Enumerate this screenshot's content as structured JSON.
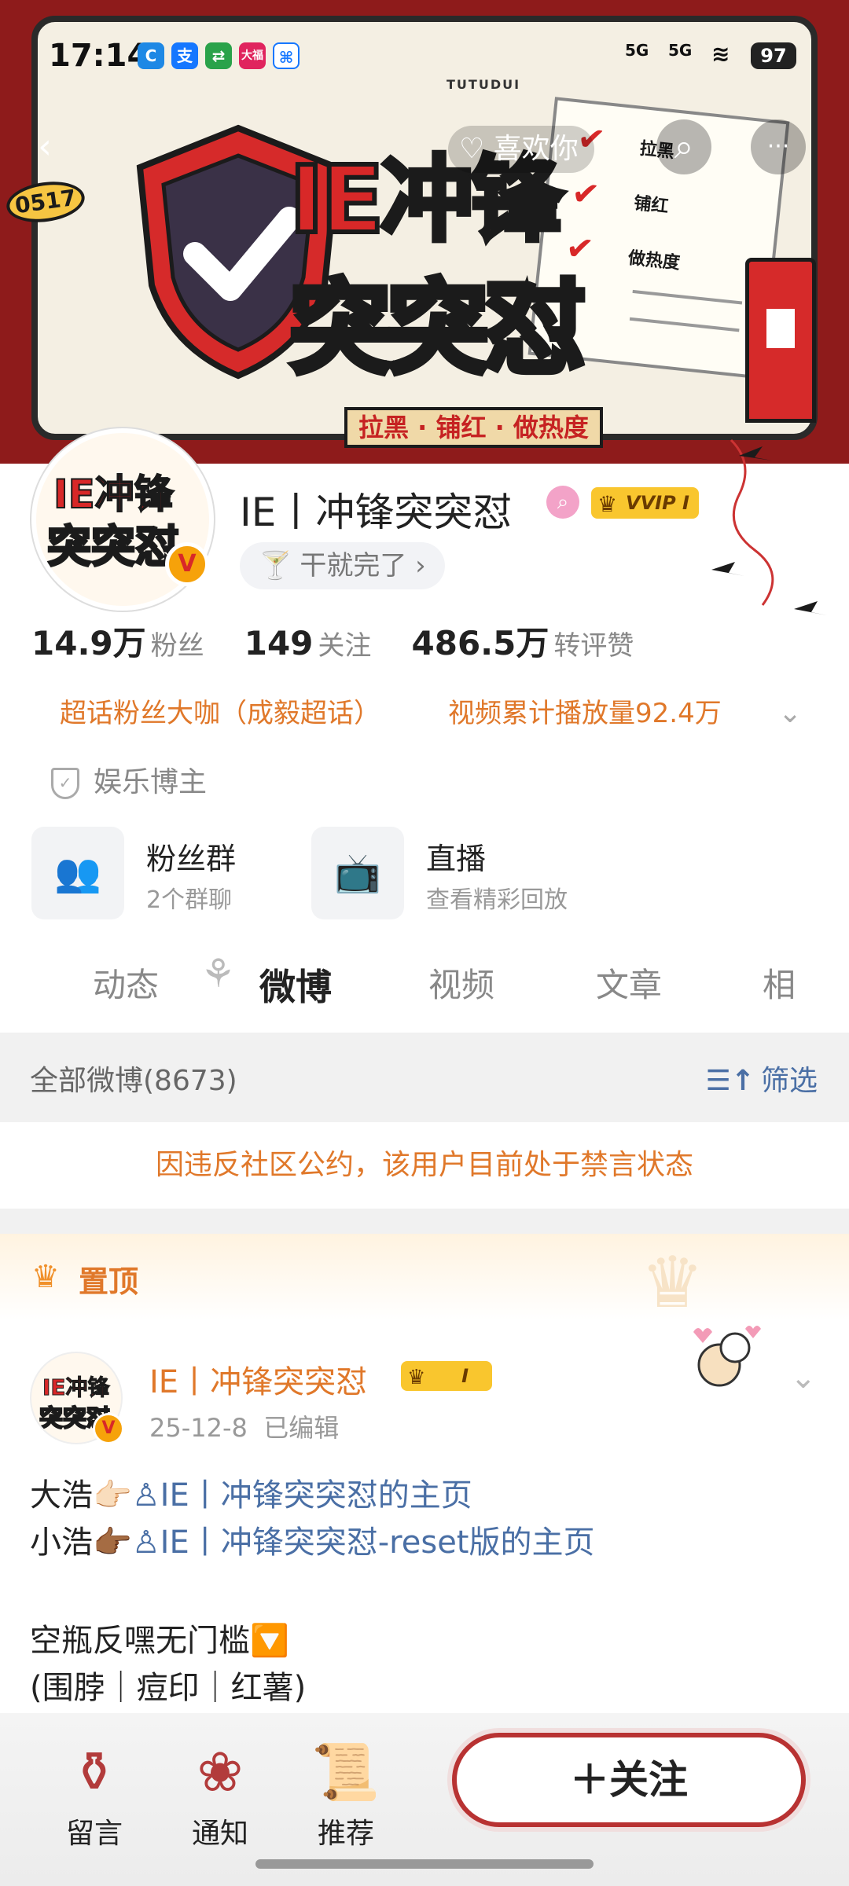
{
  "status_bar": {
    "time": "17:14",
    "signal_1": "5G",
    "signal_2": "5G",
    "battery": "97",
    "app_icon_labels": [
      "大福"
    ]
  },
  "banner": {
    "brand": "TUTUDUI",
    "title_line1": "IE冲锋",
    "title_line2_white": "突突",
    "title_line2_red": "怼",
    "subtitle": "拉黑 · 铺红 · 做热度",
    "badge": "0517",
    "checklist": [
      "拉黑",
      "铺红",
      "做热度"
    ],
    "hash": "#"
  },
  "nav": {
    "back_icon": "‹",
    "like_label": "喜欢你",
    "search_icon": "⌕",
    "more_icon": "···"
  },
  "profile": {
    "avatar_text1": "IE冲锋",
    "avatar_text2": "突突怼",
    "verified_mark": "V",
    "name": "IE丨冲锋突突怼",
    "vip_label": "VVIP I",
    "status_text": "干就完了",
    "stats": [
      {
        "num": "14.9万",
        "label": "粉丝"
      },
      {
        "num": "149",
        "label": "关注"
      },
      {
        "num": "486.5万",
        "label": "转评赞"
      }
    ],
    "honors": [
      "超话粉丝大咖（成毅超话）",
      "视频累计播放量92.4万"
    ],
    "tag": "娱乐博主",
    "cards": [
      {
        "title": "粉丝群",
        "sub": "2个群聊"
      },
      {
        "title": "直播",
        "sub": "查看精彩回放"
      }
    ]
  },
  "tabs": [
    "动态",
    "微博",
    "视频",
    "文章",
    "相"
  ],
  "feed": {
    "all_label": "全部微博(8673)",
    "filter_label": "筛选",
    "notice": "因违反社区公约，该用户目前处于禁言状态",
    "pinned_label": "置顶"
  },
  "post": {
    "author": "IE丨冲锋突突怼",
    "vip_label": "I",
    "date": "25-12-8",
    "edited": "已编辑",
    "line1_prefix": "大浩👉🏻",
    "line1_link": "IE丨冲锋突突怼的主页",
    "line2_prefix": "小浩👉🏾",
    "line2_link": "IE丨冲锋突突怼-reset版的主页",
    "line3": "空瓶反嘿无门槛🔽",
    "line4": "(围脖｜痘印｜红薯)"
  },
  "bottom_bar": {
    "items": [
      "留言",
      "通知",
      "推荐"
    ],
    "follow_label": "＋关注"
  },
  "colors": {
    "accent_orange": "#e0782a",
    "link_blue": "#4a6fa5",
    "banner_red": "#8e1b1b",
    "vip_gold": "#f9c62e"
  }
}
